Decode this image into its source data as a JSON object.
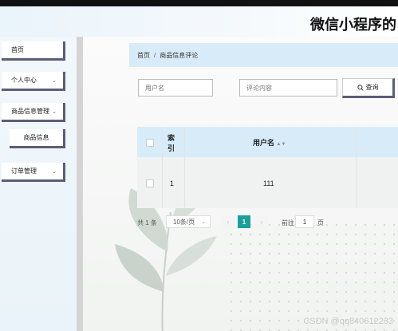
{
  "header": {
    "title": "微信小程序的"
  },
  "sidebar": {
    "items": [
      {
        "label": "首页",
        "has_chevron": false
      },
      {
        "label": "个人中心",
        "has_chevron": true
      },
      {
        "label": "商品信息管理",
        "has_chevron": true
      },
      {
        "label": "商品信息",
        "has_chevron": false
      },
      {
        "label": "订单管理",
        "has_chevron": true
      }
    ]
  },
  "breadcrumb": {
    "home": "首页",
    "separator": "/",
    "current": "商品信息评论"
  },
  "search": {
    "username_placeholder": "用户名",
    "comment_placeholder": "评论内容",
    "button_label": "查询"
  },
  "table": {
    "columns": {
      "index_top": "索",
      "index_bottom": "引",
      "username": "用户名"
    },
    "rows": [
      {
        "index": "1",
        "username": "111"
      }
    ]
  },
  "pagination": {
    "total": "共 1 条",
    "page_size": "10条/页",
    "current_page": "1",
    "goto_label": "前往",
    "goto_value": "1",
    "goto_unit": "页"
  },
  "watermark": "CSDN @qq840612233",
  "colors": {
    "accent": "#1aa09a",
    "header_blue": "#d7ecf8",
    "menu_border": "#5c5d78"
  }
}
